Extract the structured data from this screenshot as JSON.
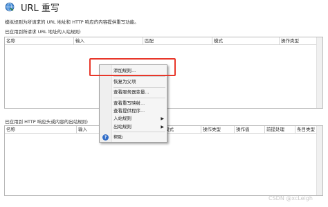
{
  "header": {
    "title": "URL 重写"
  },
  "description": "模拟规则为所请求的 URL 地址和 HTTP 响应的内容提供重写功能。",
  "inbound": {
    "label": "已应用到所请求 URL 地址的入站规则:",
    "columns": [
      "名称",
      "输入",
      "匹配",
      "模式",
      "操作类型"
    ]
  },
  "outbound": {
    "label": "已应用到 HTTP 响应头或内容的出站规则:",
    "columns": [
      "名称",
      "输入",
      "匹配",
      "模式",
      "操作类型",
      "操作值",
      "前提处理",
      "条目类型"
    ]
  },
  "menu": {
    "add_rule": "添加规则...",
    "restore_parent": "恢复为父项",
    "view_server_vars": "查看服务器变量...",
    "view_rewrite_maps": "查看重写映射...",
    "view_providers": "查看提供程序...",
    "inbound_rules": "入站规则",
    "outbound_rules": "出站规则",
    "help": "帮助"
  },
  "watermark": "CSDN @xcLeigh"
}
